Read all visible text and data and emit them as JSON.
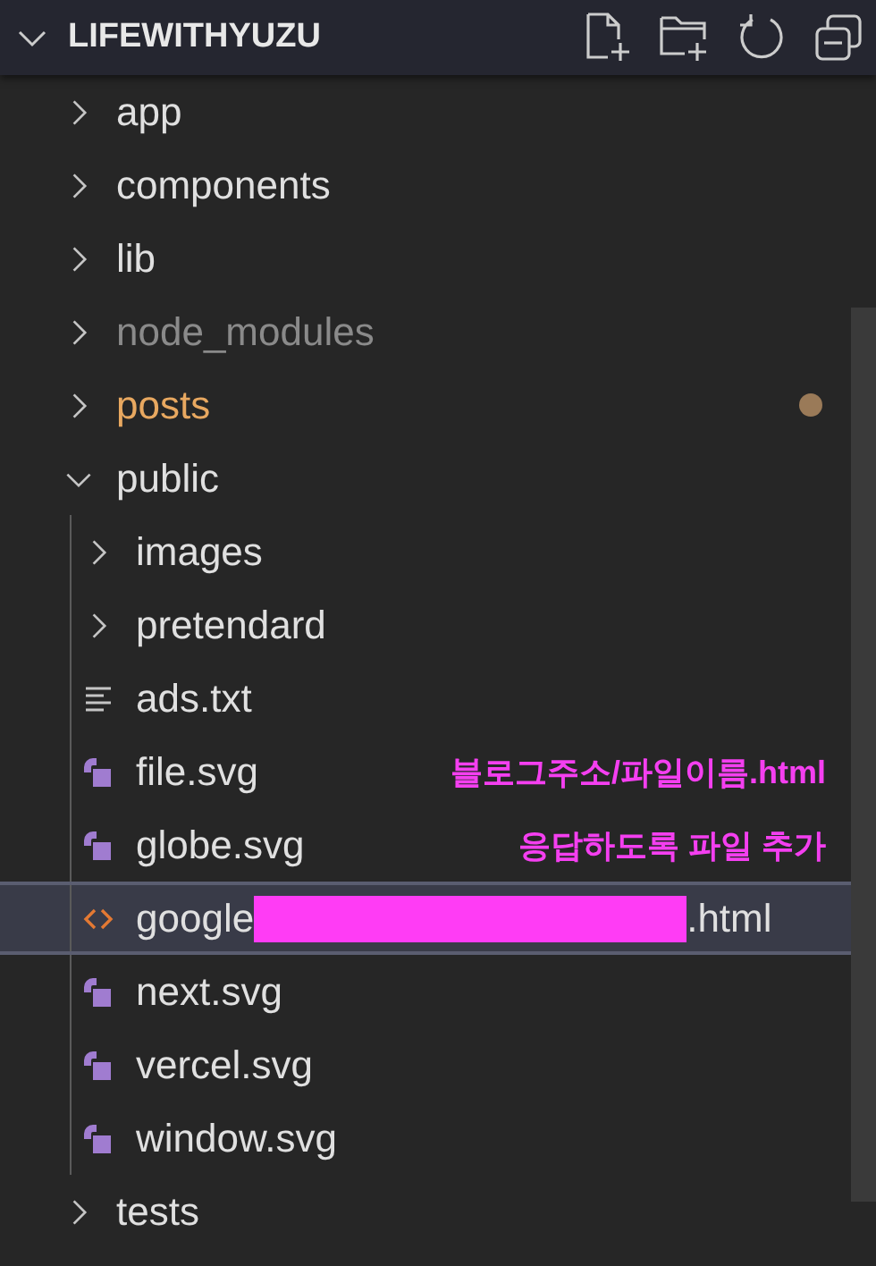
{
  "header": {
    "title": "LIFEWITHYUZU",
    "expanded": true
  },
  "tree": [
    {
      "name": "app",
      "kind": "folder",
      "expanded": false,
      "selected": false,
      "ignored": false,
      "modified": false
    },
    {
      "name": "components",
      "kind": "folder",
      "expanded": false,
      "selected": false,
      "ignored": false,
      "modified": false
    },
    {
      "name": "lib",
      "kind": "folder",
      "expanded": false,
      "selected": false,
      "ignored": false,
      "modified": false
    },
    {
      "name": "node_modules",
      "kind": "folder",
      "expanded": false,
      "selected": false,
      "ignored": true,
      "modified": false
    },
    {
      "name": "posts",
      "kind": "folder",
      "expanded": false,
      "selected": false,
      "ignored": false,
      "modified": true
    },
    {
      "name": "public",
      "kind": "folder",
      "expanded": true,
      "selected": false,
      "ignored": false,
      "modified": false,
      "children": [
        {
          "name": "images",
          "kind": "folder",
          "expanded": false,
          "selected": false
        },
        {
          "name": "pretendard",
          "kind": "folder",
          "expanded": false,
          "selected": false
        },
        {
          "name": "ads.txt",
          "kind": "text",
          "selected": false
        },
        {
          "name": "file.svg",
          "kind": "svg",
          "selected": false,
          "note": "블로그주소/파일이름.html"
        },
        {
          "name": "globe.svg",
          "kind": "svg",
          "selected": false,
          "note": "응답하도록 파일 추가"
        },
        {
          "name": "google",
          "name_end": ".html",
          "redacted": true,
          "kind": "html",
          "selected": true
        },
        {
          "name": "next.svg",
          "kind": "svg",
          "selected": false
        },
        {
          "name": "vercel.svg",
          "kind": "svg",
          "selected": false
        },
        {
          "name": "window.svg",
          "kind": "svg",
          "selected": false
        }
      ]
    },
    {
      "name": "tests",
      "kind": "folder",
      "expanded": false,
      "selected": false,
      "ignored": false,
      "modified": false
    }
  ]
}
